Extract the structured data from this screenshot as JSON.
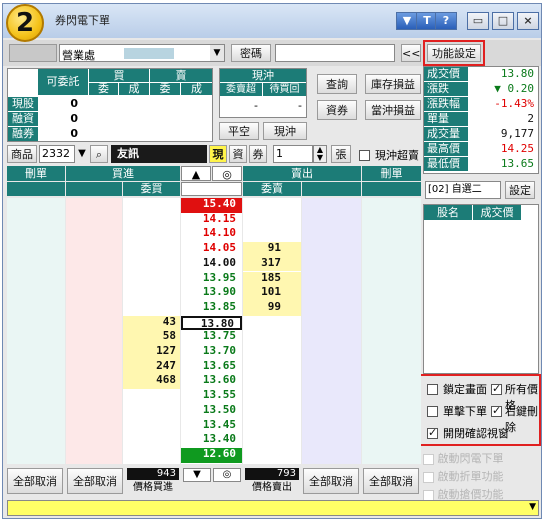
{
  "window": {
    "title": "券閃電下單",
    "badge": "2",
    "btn_help": "?",
    "btn_t": "T"
  },
  "toolbar": {
    "branch": "營業處",
    "password_button": "密碼",
    "collapse_button": "<<",
    "function_settings": "功能設定"
  },
  "account_table": {
    "col_available": "可委託",
    "col_buy": "買",
    "col_sell": "賣",
    "sub_order": "委",
    "sub_fill": "成",
    "rows": [
      {
        "label": "現股",
        "value": "0"
      },
      {
        "label": "融資",
        "value": "0"
      },
      {
        "label": "融券",
        "value": "0"
      }
    ]
  },
  "daytrade": {
    "title": "現沖",
    "col_sell_first": "委賣超",
    "col_pending_buy": "待買回",
    "val1": "-",
    "val2": "-",
    "btn_flat": "平空",
    "btn_daytrade": "現沖"
  },
  "action_buttons": {
    "query": "查詢",
    "inventory_pl": "庫存損益",
    "securities": "資券",
    "daytrade_pl": "當沖損益"
  },
  "stock": {
    "label": "商品",
    "code": "2332",
    "name": "友訊",
    "type_cash": "現",
    "type_margin": "資",
    "type_short": "券",
    "qty": "1",
    "unit": "張",
    "daytrade_oversell": "現沖超賣"
  },
  "info": {
    "rows": [
      {
        "label": "成交價",
        "value": "13.80",
        "color": "#0a7a1a"
      },
      {
        "label": "漲跌",
        "value": "▼ 0.20",
        "color": "#0a7a1a"
      },
      {
        "label": "漲跌幅",
        "value": "-1.43%",
        "color": "#e00000"
      },
      {
        "label": "單量",
        "value": "2",
        "color": "#111111"
      },
      {
        "label": "成交量",
        "value": "9,177",
        "color": "#111111"
      },
      {
        "label": "最高價",
        "value": "14.25",
        "color": "#e00000"
      },
      {
        "label": "最低價",
        "value": "13.65",
        "color": "#0a7a1a"
      }
    ],
    "watchlist": "[02] 自選二",
    "settings_button": "設定",
    "col_stock": "股名",
    "col_price": "成交價"
  },
  "ladder": {
    "hdr_delete_left": "刪單",
    "hdr_buy": "買進",
    "hdr_sell": "賣出",
    "hdr_delete_right": "刪單",
    "sub_bid": "委買",
    "sub_ask": "委賣",
    "up_arrow": "▲",
    "down_arrow": "▼",
    "center_icon": "◎",
    "rows": [
      {
        "price": "15.40",
        "bid": "",
        "ask": "",
        "style": "limitup"
      },
      {
        "price": "14.15",
        "bid": "",
        "ask": "",
        "style": "red"
      },
      {
        "price": "14.10",
        "bid": "",
        "ask": "",
        "style": "red"
      },
      {
        "price": "14.05",
        "bid": "",
        "ask": "91",
        "style": "red"
      },
      {
        "price": "14.00",
        "bid": "",
        "ask": "317",
        "style": "dark"
      },
      {
        "price": "13.95",
        "bid": "",
        "ask": "185",
        "style": "green"
      },
      {
        "price": "13.90",
        "bid": "",
        "ask": "101",
        "style": "green"
      },
      {
        "price": "13.85",
        "bid": "",
        "ask": "99",
        "style": "green"
      },
      {
        "price": "13.80",
        "bid": "43",
        "ask": "",
        "style": "current"
      },
      {
        "price": "13.75",
        "bid": "58",
        "ask": "",
        "style": "green"
      },
      {
        "price": "13.70",
        "bid": "127",
        "ask": "",
        "style": "green"
      },
      {
        "price": "13.65",
        "bid": "247",
        "ask": "",
        "style": "green"
      },
      {
        "price": "13.60",
        "bid": "468",
        "ask": "",
        "style": "green"
      },
      {
        "price": "13.55",
        "bid": "",
        "ask": "",
        "style": "green"
      },
      {
        "price": "13.50",
        "bid": "",
        "ask": "",
        "style": "green"
      },
      {
        "price": "13.45",
        "bid": "",
        "ask": "",
        "style": "green"
      },
      {
        "price": "13.40",
        "bid": "",
        "ask": "",
        "style": "green"
      },
      {
        "price": "12.60",
        "bid": "",
        "ask": "",
        "style": "limitdown"
      }
    ]
  },
  "bottom": {
    "cancel_all": "全部取消",
    "buy_total": "943",
    "sell_total": "793",
    "price_buy": "價格買進",
    "price_sell": "價格賣出"
  },
  "options": {
    "lock_screen": "鎖定畫面",
    "all_prices": "所有價格",
    "one_click": "單擊下單",
    "right_click_delete": "右鍵刪除",
    "confirm_window": "開閉確認視窗",
    "faded1": "啟動閃電下單",
    "faded2": "啟動折單功能",
    "faded3": "啟動搶價功能"
  }
}
